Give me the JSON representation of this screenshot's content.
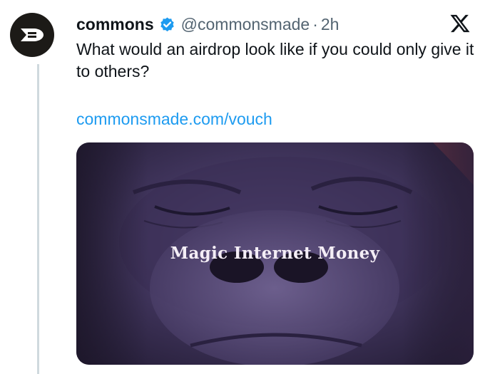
{
  "tweet": {
    "author_name": "commons",
    "author_handle": "@commonsmade",
    "separator": "·",
    "timestamp": "2h",
    "text": "What would an airdrop look like if you could only give it to others?",
    "link": "commonsmade.com/vouch",
    "media_caption": "Magic Internet Money"
  },
  "icons": {
    "avatar": "commons-logo-icon",
    "verified": "verified-badge-icon",
    "platform": "x-logo-icon"
  },
  "colors": {
    "link": "#1d9bf0",
    "verified": "#1d9bf0",
    "secondary_text": "#536471",
    "avatar_bg": "#1c1a17",
    "media_tint": "#4b3f6e"
  }
}
